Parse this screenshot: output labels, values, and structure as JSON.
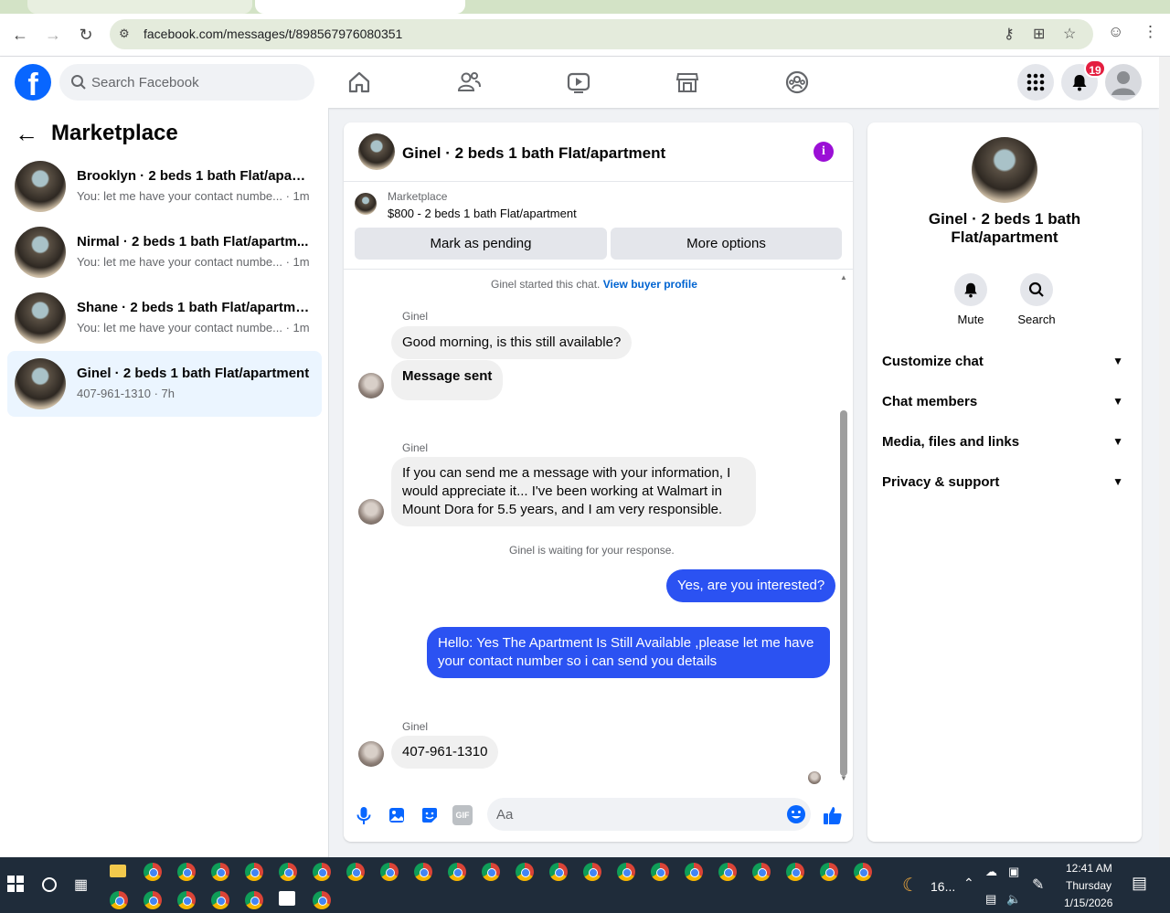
{
  "browser": {
    "url": "facebook.com/messages/t/898567976080351"
  },
  "header": {
    "logo": "f",
    "search_placeholder": "Search Facebook",
    "notification_count": "19"
  },
  "sidebar": {
    "back_icon": "arrow-left-icon",
    "title": "Marketplace",
    "conversations": [
      {
        "name": "Brooklyn · 2 beds 1 bath Flat/apart...",
        "snippet": "You: let me have your contact numbe... · 1m",
        "active": false
      },
      {
        "name": "Nirmal · 2 beds 1 bath Flat/apartm...",
        "snippet": "You: let me have your contact numbe... · 1m",
        "active": false
      },
      {
        "name": "Shane · 2 beds 1 bath Flat/apartme...",
        "snippet": "You: let me have your contact numbe... · 1m",
        "active": false
      },
      {
        "name": "Ginel · 2 beds 1 bath Flat/apartment",
        "snippet": "407-961-1310 · 7h",
        "active": true
      }
    ]
  },
  "chat": {
    "title": "Ginel · 2 beds 1 bath Flat/apartment",
    "info_label": "i",
    "marketplace_label": "Marketplace",
    "listing": "$800 - 2 beds 1 bath Flat/apartment",
    "mark_pending": "Mark as pending",
    "more_options": "More options",
    "started_text": "Ginel started this chat.",
    "view_profile": "View buyer profile",
    "sender": "Ginel",
    "msg1": "Good morning, is this still available?",
    "msg2": "Message sent",
    "msg3": "If you can send me a message with your information, I would appreciate it... I've been working at Walmart in Mount Dora for 5.5 years, and I am very responsible.",
    "waiting_text": "Ginel is waiting for your response.",
    "out1": "Yes, are you interested?",
    "out2": "Hello: Yes The Apartment Is Still Available ,please let me have your contact number so i can send you details",
    "msg4": "407-961-1310",
    "composer_placeholder": "Aa",
    "gif_label": "GIF"
  },
  "details": {
    "title": "Ginel · 2 beds 1 bath Flat/apartment",
    "mute": "Mute",
    "search": "Search",
    "rows": [
      "Customize chat",
      "Chat members",
      "Media, files and links",
      "Privacy & support"
    ]
  },
  "taskbar": {
    "weather": "16...",
    "time": "12:41 AM",
    "day": "Thursday",
    "date": "1/15/2026"
  },
  "colors": {
    "fb_blue": "#0866ff",
    "outgoing_bubble": "#2b52f2",
    "active_conv": "#ebf5ff",
    "badge_red": "#e41e3f",
    "info_purple": "#9b0fd6"
  }
}
